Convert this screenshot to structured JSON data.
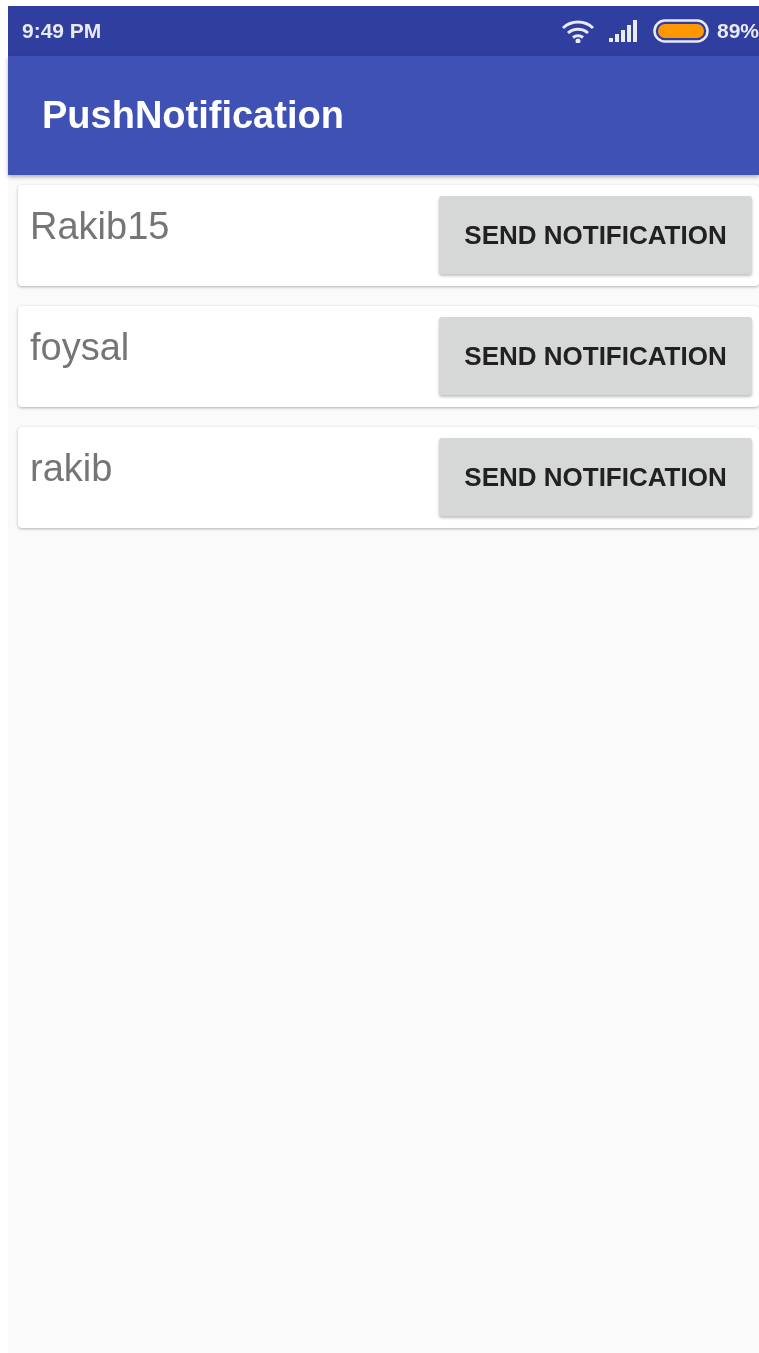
{
  "status_bar": {
    "time": "9:49 PM",
    "battery_level": "89%"
  },
  "app_bar": {
    "title": "PushNotification"
  },
  "users": [
    {
      "name": "Rakib15",
      "button": "SEND NOTIFICATION"
    },
    {
      "name": "foysal",
      "button": "SEND NOTIFICATION"
    },
    {
      "name": "rakib",
      "button": "SEND NOTIFICATION"
    }
  ]
}
